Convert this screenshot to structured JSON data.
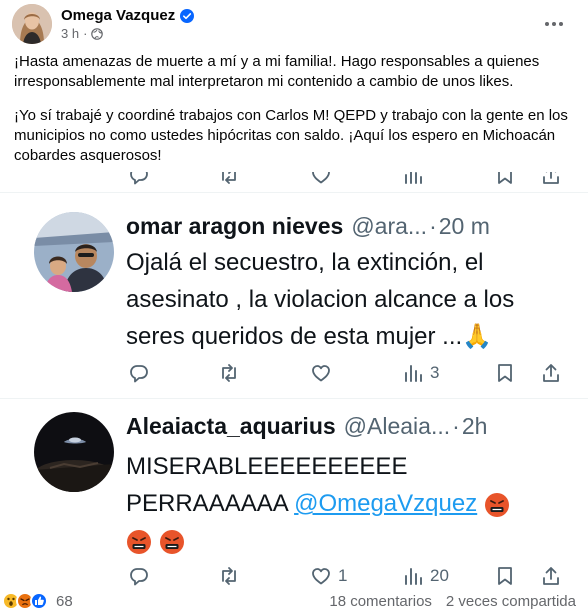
{
  "post": {
    "author": "Omega Vazquez",
    "time": "3 h",
    "time_separator": "·",
    "paragraphs": [
      "¡Hasta amenazas de muerte a mí y a mi familia!. Hago responsables a quienes irresponsablemente mal interpretaron mi contenido a cambio de unos likes.",
      "¡Yo sí trabajé y coordiné trabajos con Carlos M! QEPD y trabajo con la gente en los municipios no como ustedes hipócritas con saldo. ¡Aquí los espero en Michoacán cobardes asquerosos!"
    ]
  },
  "tweets": [
    {
      "name": "omar aragon nieves",
      "handle": "@ara...",
      "dot": "·",
      "time": "20 m",
      "lines": [
        "Ojalá el secuestro, la extinción, el",
        "asesinato , la violacion alcance a los",
        "seres queridos de esta mujer ...🙏"
      ],
      "stats": {
        "replies": "",
        "retweets": "",
        "likes": "",
        "views": "3"
      }
    },
    {
      "name": "Aleaiacta_aquarius",
      "handle": "@Aleaia...",
      "dot": "·",
      "time": "2h",
      "line1": "MISERABLEEEEEEEEEE",
      "line2": "PERRAAAAAA",
      "mention": "@OmegaVzquez",
      "stats": {
        "replies": "",
        "retweets": "",
        "likes": "1",
        "views": "20"
      }
    }
  ],
  "footer": {
    "reaction_count": "68",
    "comments": "18 comentarios",
    "shares": "2 veces compartida"
  },
  "icons": {
    "verified": "verified-badge-icon",
    "globe": "globe-icon",
    "more": "more-options-icon",
    "reply": "reply-icon",
    "retweet": "retweet-icon",
    "like": "like-icon",
    "views": "views-icon",
    "bookmark": "bookmark-icon",
    "share": "share-icon",
    "reactions": [
      "wow-icon",
      "angry-icon",
      "like-reaction-icon"
    ]
  },
  "colors": {
    "fb_blue": "#0866ff",
    "twitter_blue": "#1d9bf0",
    "muted": "#65676b",
    "tweet_muted": "#536471"
  }
}
